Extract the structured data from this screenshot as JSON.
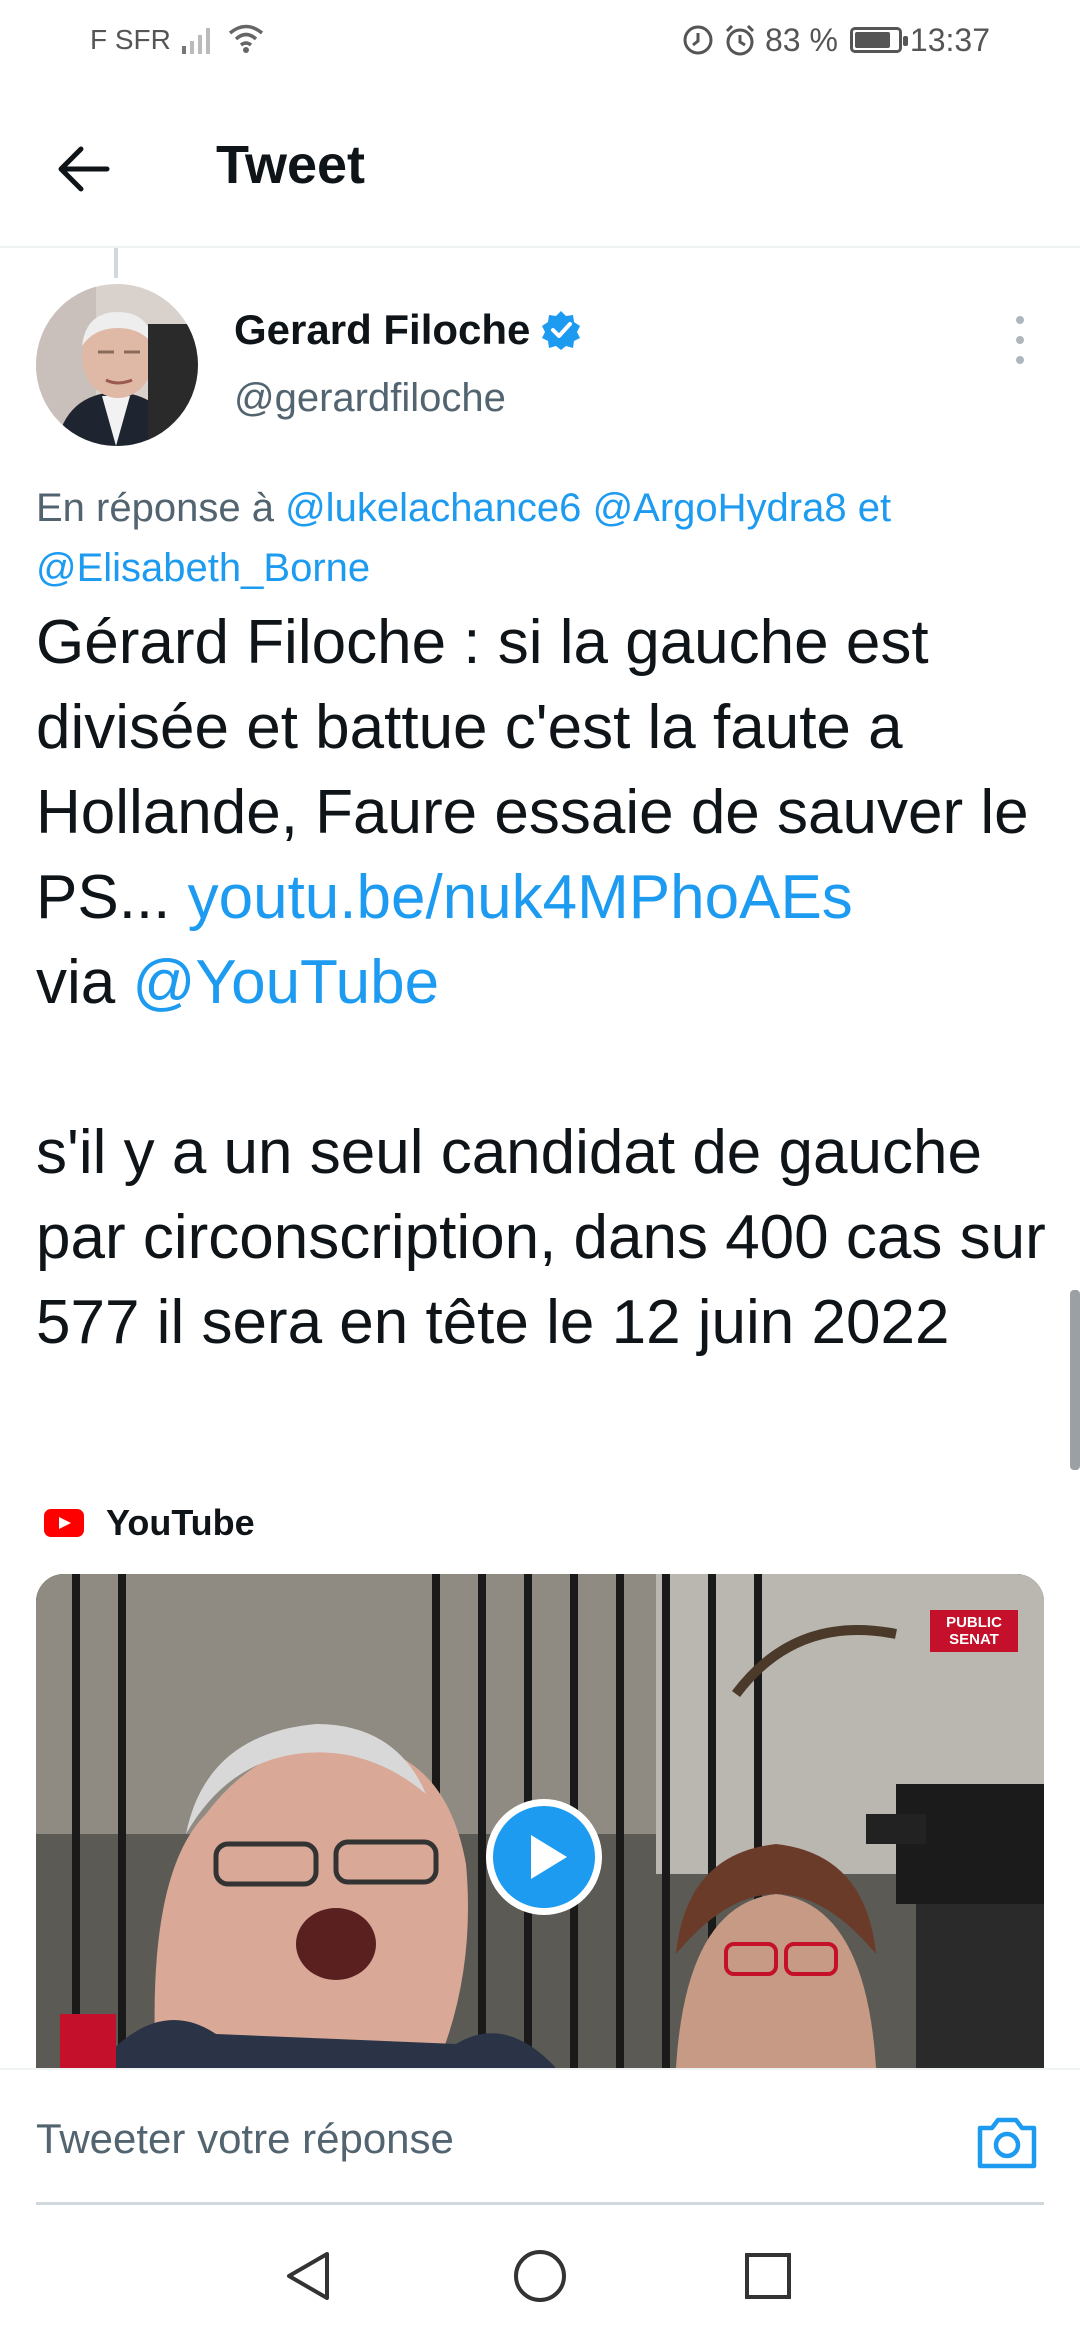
{
  "status_bar": {
    "carrier": "F SFR",
    "battery": "83 %",
    "battery_level": 0.83,
    "time": "13:37"
  },
  "header": {
    "title": "Tweet"
  },
  "tweet": {
    "author_name": "Gerard Filoche",
    "author_handle": "@gerardfiloche",
    "verified": true,
    "reply_prefix": "En réponse à",
    "reply_mentions": [
      "@lukelachance6",
      "@ArgoHydra8"
    ],
    "reply_and": "et",
    "reply_last_mention": "@Elisabeth_Borne",
    "text_part1": "Gérard Filoche : si la gauche est divisée et battue c'est la faute a Hollande, Faure essaie de sauver le PS... ",
    "text_link": "youtu.be/nuk4MPhoAEs",
    "text_via": "via ",
    "text_via_mention": "@YouTube",
    "text_paragraph2": "s'il y a un seul candidat de gauche par circonscription, dans 400 cas sur 577 il sera en tête le 12 juin 2022",
    "card_source": "YouTube",
    "video_logo": "PUBLIC SENAT"
  },
  "reply_bar": {
    "placeholder": "Tweeter votre réponse"
  },
  "icons": {
    "back": "arrow-left-icon",
    "verified": "verified-badge-icon",
    "more": "more-vertical-icon",
    "camera": "camera-icon",
    "play": "play-icon"
  },
  "colors": {
    "accent": "#1d9bf0",
    "text": "#0f1419",
    "secondary_text": "#536471",
    "youtube_red": "#ff0000"
  }
}
